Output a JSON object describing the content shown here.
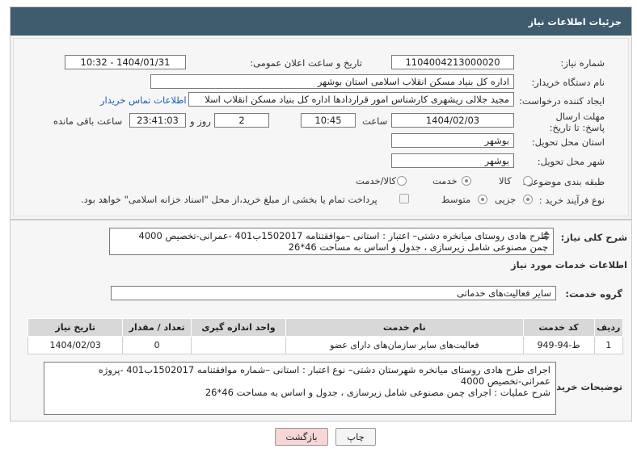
{
  "panel": {
    "title": "جزئیات اطلاعات نیاز"
  },
  "fields": {
    "need_number_label": "شماره نیاز:",
    "need_number": "1104004213000020",
    "announce_label": "تاریخ و ساعت اعلان عمومی:",
    "announce_value": "1404/01/31 - 10:32",
    "buyer_org_label": "نام دستگاه خریدار:",
    "buyer_org": "اداره کل بنیاد مسکن انقلاب اسلامی استان بوشهر",
    "creator_label": "ایجاد کننده درخواست:",
    "creator": "مجید جلالی ریشهری کارشناس امور قراردادها اداره کل بنیاد مسکن انقلاب اسلا",
    "contact_link": "اطلاعات تماس خریدار",
    "deadline_label": "مهلت ارسال پاسخ: تا تاریخ:",
    "deadline_date": "1404/02/03",
    "time_label": "ساعت",
    "deadline_time": "10:45",
    "days_value": "2",
    "days_label": "روز و",
    "remaining_time": "23:41:03",
    "remaining_label": "ساعت باقی مانده",
    "province_label": "استان محل تحویل:",
    "province": "بوشهر",
    "city_label": "شهر محل تحویل:",
    "city": "بوشهر",
    "category_label": "طبقه بندی موضوعی:",
    "category_options": [
      "کالا",
      "خدمت",
      "کالا/خدمت"
    ],
    "category_selected": "خدمت",
    "process_label": "نوع فرآیند خرید :",
    "process_options": [
      "جزیی",
      "متوسط"
    ],
    "process_selected": "جزیی",
    "treasury_note": "پرداخت تمام یا بخشی از مبلغ خرید،از محل \"اسناد خزانه اسلامی\" خواهد بود."
  },
  "summary": {
    "label": "شرح کلی نیاز:",
    "line1": "طرح هادی روستای میانخره  دشتی– اعتبار : استانی –موافقتنامه 1502017ب401 -عمرانی-تخصیص 4000",
    "line2": "چمن مصنوعی شامل زیرسازی ، جدول و اساس به مساحت 46*26"
  },
  "services": {
    "section_title": "اطلاعات خدمات مورد نیاز",
    "group_label": "گروه خدمت:",
    "group_value": "سایر فعالیت‌های خدماتی",
    "columns": [
      "ردیف",
      "کد خدمت",
      "نام خدمت",
      "واحد اندازه گیری",
      "تعداد / مقدار",
      "تاریخ نیاز"
    ],
    "rows": [
      [
        "1",
        "ط-94-949",
        "فعالیت‌های سایر سازمان‌های دارای عضو",
        "",
        "0",
        "1404/02/03"
      ]
    ]
  },
  "buyer_notes": {
    "label": "توضیحات خریدار:",
    "line1": "اجرای طرح هادی روستای میانخره  شهرستان دشتی– نوع اعتبار : استانی –شماره موافقتنامه 1502017ب401 -پروژه",
    "line2": "عمرانی-تخصیص 4000",
    "line3": "شرح عملیات : اجرای چمن مصنوعی شامل زیرسازی ، جدول و اساس به مساحت 46*26"
  },
  "buttons": {
    "print": "چاپ",
    "back": "بازگشت"
  },
  "colors": {
    "header_bg": "#3f5b6e",
    "link": "#1a5fb4",
    "back_button_bg": "#f7d6d6"
  },
  "icons": {
    "watermark": "ariatender-logo"
  }
}
